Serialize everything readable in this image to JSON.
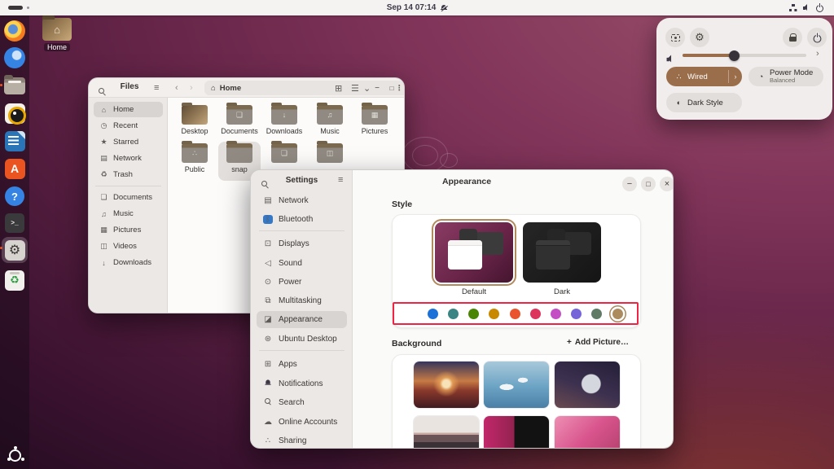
{
  "topbar": {
    "clock": "Sep 14 07:14"
  },
  "icons": {
    "hamburger": "≡",
    "kebab": "⋮",
    "back": "‹",
    "forward": "›",
    "chevron_down": "⌄",
    "chevron_right": "›",
    "minimize": "−",
    "maximize": "□",
    "close": "×",
    "home": "⌂",
    "recent": "◷",
    "starred": "★",
    "network_places": "▤",
    "trash": "♻",
    "documents": "❏",
    "music": "♫",
    "pictures": "▦",
    "videos": "◫",
    "downloads": "↓",
    "bluetooth": "ᛒ",
    "displays": "⊡",
    "sound": "◁",
    "power": "⊙",
    "multitasking": "⧉",
    "appearance": "◪",
    "ubuntu_desktop": "⊛",
    "apps": "⊞",
    "online_accounts": "☁",
    "sharing": "∴",
    "wired": "∴",
    "power_mode": "◔",
    "dark_style": "◐",
    "plus": "+",
    "grid_view": "⊞",
    "list_view": "☰",
    "gear": "⚙",
    "share": "∴",
    "house": "⌂",
    "app_center_letter": "A",
    "help_question": "?",
    "terminal_prompt": ">_",
    "trash_recycle": "♻"
  },
  "desktop": {
    "home_label": "Home"
  },
  "dock": {
    "apps": [
      "firefox",
      "thunderbird",
      "files",
      "rhythmbox",
      "libreoffice-writer",
      "app-center",
      "help",
      "terminal",
      "settings",
      "trash",
      "app-grid"
    ]
  },
  "files": {
    "app_title": "Files",
    "location": "Home",
    "sidebar": [
      {
        "label": "Home"
      },
      {
        "label": "Recent"
      },
      {
        "label": "Starred"
      },
      {
        "label": "Network"
      },
      {
        "label": "Trash"
      },
      {
        "label": "Documents"
      },
      {
        "label": "Music"
      },
      {
        "label": "Pictures"
      },
      {
        "label": "Videos"
      },
      {
        "label": "Downloads"
      }
    ],
    "grid_row1": [
      {
        "label": "Desktop"
      },
      {
        "label": "Documents"
      },
      {
        "label": "Downloads"
      },
      {
        "label": "Music"
      },
      {
        "label": "Pictures"
      }
    ],
    "grid_row2": [
      {
        "label": "Public"
      },
      {
        "label": "snap"
      },
      {
        "label": ""
      },
      {
        "label": ""
      }
    ]
  },
  "settings": {
    "app_title": "Settings",
    "page_title": "Appearance",
    "sidebar": [
      "Network",
      "Bluetooth",
      "Displays",
      "Sound",
      "Power",
      "Multitasking",
      "Appearance",
      "Ubuntu Desktop",
      "Apps",
      "Notifications",
      "Search",
      "Online Accounts",
      "Sharing"
    ],
    "selected_item": "Appearance",
    "style": {
      "heading": "Style",
      "themes": [
        {
          "label": "Default",
          "selected": true
        },
        {
          "label": "Dark",
          "selected": false
        }
      ],
      "accents": [
        "#1c71d8",
        "#3a8484",
        "#4a8604",
        "#c88800",
        "#e9542f",
        "#dd345e",
        "#c44fc4",
        "#7764d8",
        "#5f7b66",
        "#ac8b5e"
      ],
      "selected_accent": "#ac8b5e"
    },
    "background": {
      "heading": "Background",
      "add_button": "Add Picture…"
    }
  },
  "quick_settings": {
    "volume_fill": "42%",
    "tiles": {
      "wired": {
        "label": "Wired",
        "active": true
      },
      "power_mode": {
        "label": "Power Mode",
        "sublabel": "Balanced"
      },
      "dark_style": {
        "label": "Dark Style",
        "active": false
      }
    }
  },
  "colors": {
    "accent_brown": "#9a6e4a",
    "annotation_red": "#ef2343"
  }
}
